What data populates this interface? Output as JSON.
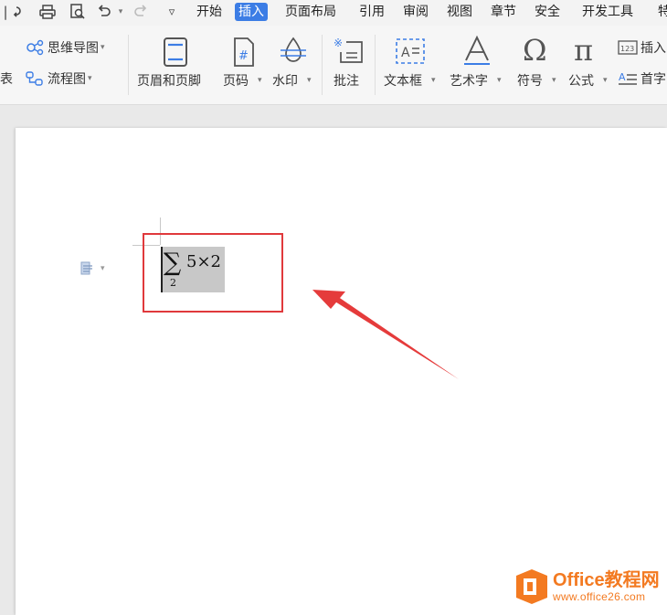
{
  "quick_access": {
    "icons": [
      "redo-left-icon",
      "print-icon",
      "print-preview-icon",
      "undo-icon",
      "redo-icon",
      "customize-icon"
    ]
  },
  "menu_tabs": [
    "开始",
    "插入",
    "页面布局",
    "引用",
    "审阅",
    "视图",
    "章节",
    "安全",
    "开发工具",
    "特"
  ],
  "active_tab": "插入",
  "ribbon": {
    "partial_left_label": "图表",
    "mindmap_label": "思维导图",
    "flowchart_label": "流程图",
    "header_footer_label": "页眉和页脚",
    "page_number_label": "页码",
    "watermark_label": "水印",
    "comment_label": "批注",
    "textbox_label": "文本框",
    "wordart_label": "艺术字",
    "symbol_label": "符号",
    "formula_label": "公式",
    "insert_number_label": "插入",
    "dropcap_label": "首字"
  },
  "equation": {
    "operator": "∑",
    "subscript": "2",
    "expression": "5×2"
  },
  "watermark": {
    "title": "Office教程网",
    "url": "www.office26.com"
  }
}
